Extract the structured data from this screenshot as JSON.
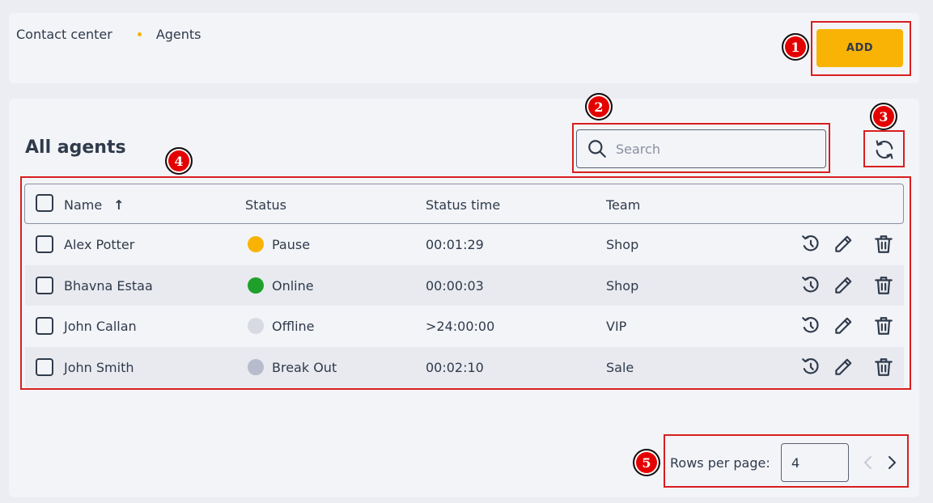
{
  "breadcrumb": {
    "root": "Contact center",
    "current": "Agents"
  },
  "header": {
    "add_label": "ADD"
  },
  "main": {
    "title": "All agents",
    "search_placeholder": "Search"
  },
  "table": {
    "columns": {
      "name": "Name",
      "sort_indicator": "↑",
      "status": "Status",
      "status_time": "Status time",
      "team": "Team"
    },
    "rows": [
      {
        "name": "Alex Potter",
        "status": "Pause",
        "status_color": "#f9b305",
        "status_time": "00:01:29",
        "team": "Shop"
      },
      {
        "name": "Bhavna Estaa",
        "status": "Online",
        "status_color": "#1fa02a",
        "status_time": "00:00:03",
        "team": "Shop"
      },
      {
        "name": "John Callan",
        "status": "Offline",
        "status_color": "#d7dae2",
        "status_time": ">24:00:00",
        "team": "VIP"
      },
      {
        "name": "John Smith",
        "status": "Break Out",
        "status_color": "#b6bccb",
        "status_time": "00:02:10",
        "team": "Sale"
      }
    ],
    "row_actions": [
      "history-icon",
      "edit-icon",
      "delete-icon"
    ]
  },
  "pagination": {
    "rows_label": "Rows per page:",
    "rows_value": "4"
  },
  "annotations": {
    "m1": "1",
    "m2": "2",
    "m3": "3",
    "m4": "4",
    "m5": "5"
  },
  "colors": {
    "accent": "#f9b305",
    "highlight": "#d81e1e",
    "marker": "#e40000"
  }
}
